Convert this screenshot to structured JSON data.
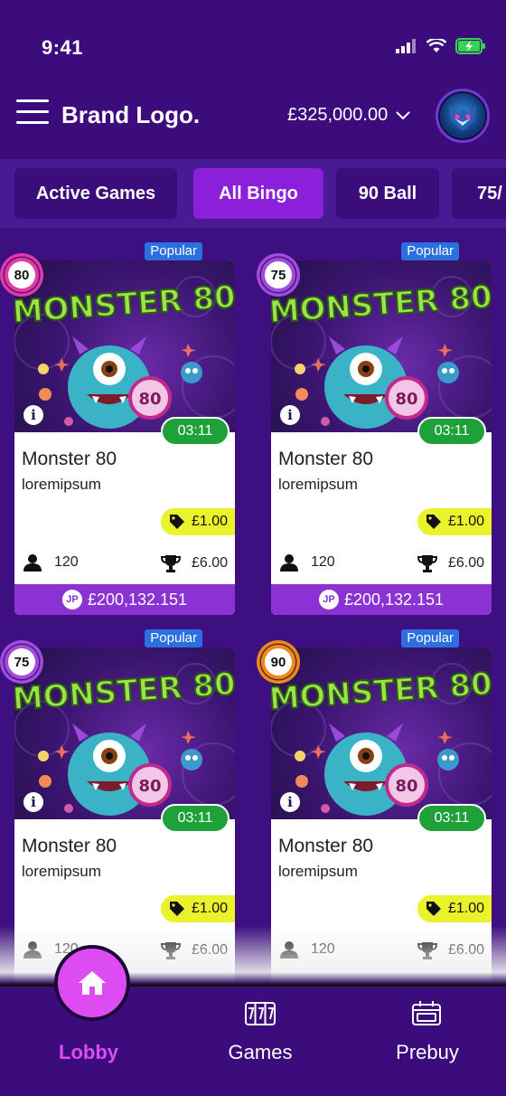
{
  "status": {
    "time": "9:41"
  },
  "header": {
    "brand": "Brand Logo.",
    "balance": "£325,000.00"
  },
  "tabs": [
    {
      "label": "Active Games",
      "active": false
    },
    {
      "label": "All Bingo",
      "active": true
    },
    {
      "label": "90 Ball",
      "active": false
    },
    {
      "label": "75/",
      "active": false
    }
  ],
  "cards": [
    {
      "popular": "Popular",
      "ball": "80",
      "ball_color": "#e23aa8",
      "art_title": "MONSTER 80",
      "art_ball": "80",
      "timer": "03:11",
      "title": "Monster 80",
      "subtitle": "loremipsum",
      "price": "£1.00",
      "players": "120",
      "prize": "£6.00",
      "jackpot": "£200,132.151",
      "jp_label": "JP"
    },
    {
      "popular": "Popular",
      "ball": "75",
      "ball_color": "#a24be0",
      "art_title": "MONSTER 80",
      "art_ball": "80",
      "timer": "03:11",
      "title": "Monster 80",
      "subtitle": "loremipsum",
      "price": "£1.00",
      "players": "120",
      "prize": "£6.00",
      "jackpot": "£200,132.151",
      "jp_label": "JP"
    },
    {
      "popular": "Popular",
      "ball": "75",
      "ball_color": "#a24be0",
      "art_title": "MONSTER 80",
      "art_ball": "80",
      "timer": "03:11",
      "title": "Monster 80",
      "subtitle": "loremipsum",
      "price": "£1.00",
      "players": "120",
      "prize": "£6.00"
    },
    {
      "popular": "Popular",
      "ball": "90",
      "ball_color": "#f08a12",
      "art_title": "MONSTER 80",
      "art_ball": "80",
      "timer": "03:11",
      "title": "Monster 80",
      "subtitle": "loremipsum",
      "price": "£1.00",
      "players": "120",
      "prize": "£6.00"
    }
  ],
  "nav": {
    "lobby": "Lobby",
    "games": "Games",
    "prebuy": "Prebuy"
  },
  "colors": {
    "background": "#3e0f80",
    "tab_active": "#8c1fd9",
    "timer": "#1fa13a",
    "price_tag": "#e9f22a",
    "jackpot": "#8b32d4",
    "lobby_active": "#dd4bf2"
  }
}
